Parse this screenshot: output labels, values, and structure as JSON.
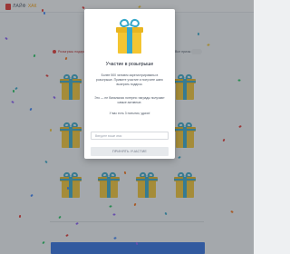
{
  "header": {
    "logo_text": "ЛАЙФ",
    "logo_accent": "ХАК"
  },
  "background": {
    "left_label": "Розыгрыш подарков",
    "right_label": "Все призы"
  },
  "modal": {
    "title": "Участие в розыгрыше",
    "paragraph_1": "Более 500 человек зарегистрированы в розыгрыше. Примите участие и получите шанс выиграть подарок.",
    "paragraph_2": "Это — не банальная лотерея: награды получают самые активные.",
    "paragraph_3": "У вас есть 3 попытки, удачи!",
    "input_placeholder": "Введите ваше имя",
    "submit_label": "ПРИНЯТЬ УЧАСТИЕ"
  },
  "colors": {
    "gift_box": "#f4c531",
    "gift_ribbon": "#37a8c9",
    "brand_red": "#e3342f",
    "footer_blue": "#2f6fe0"
  }
}
